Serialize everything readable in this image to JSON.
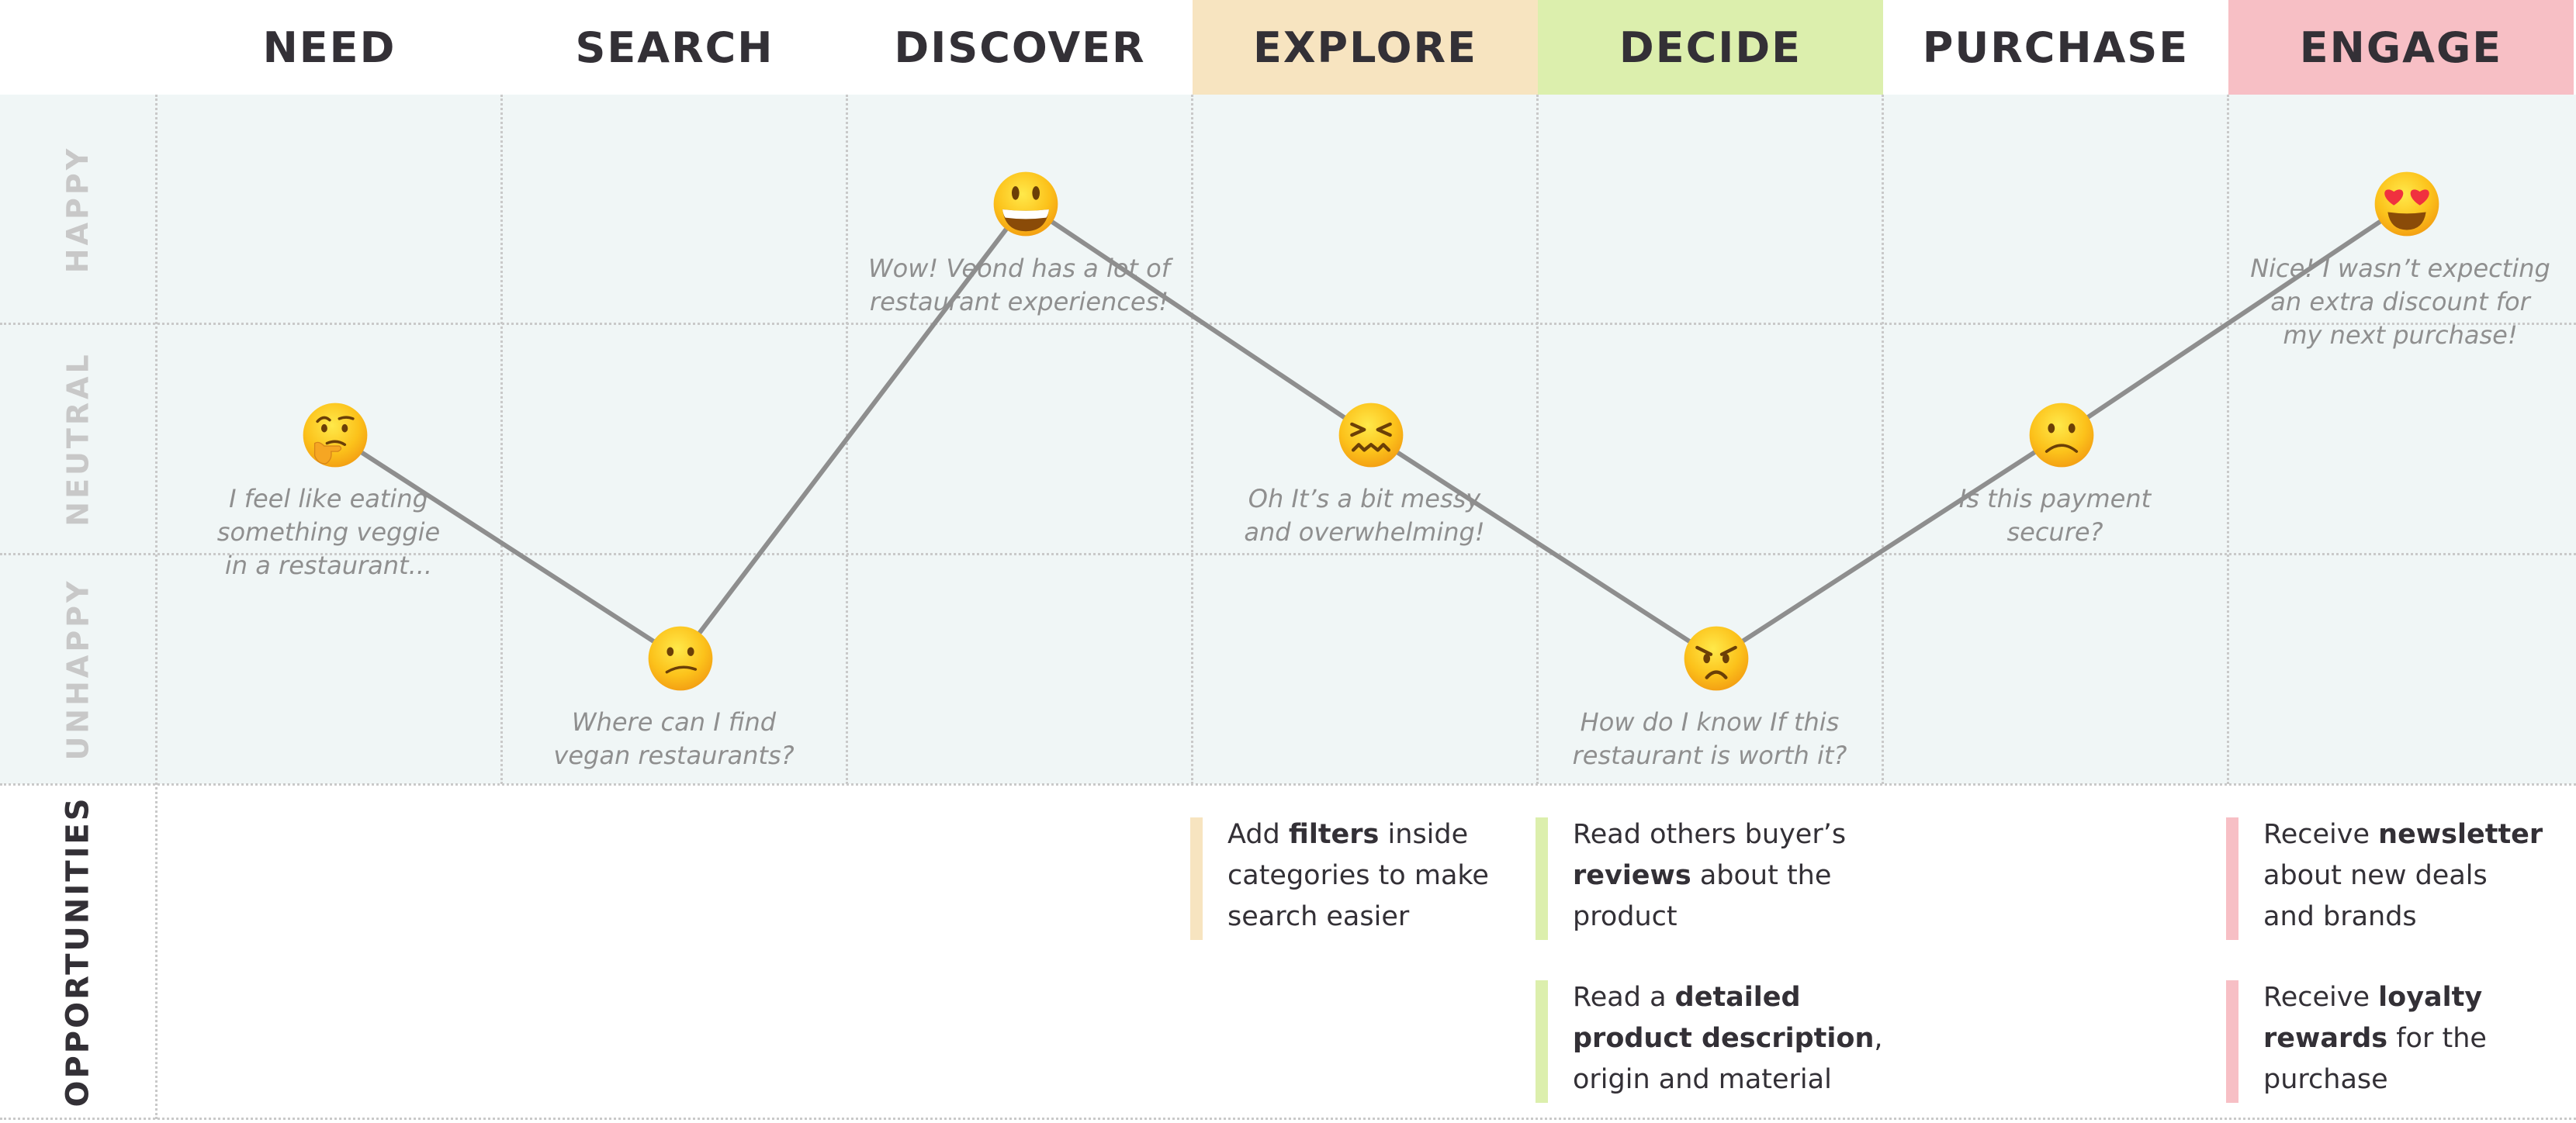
{
  "stages": [
    {
      "label": "NEED",
      "header_color": "#ffffff",
      "emotion": "neutral",
      "emoji_icon": "thinking-face-icon",
      "quote": [
        "I feel like eating",
        "something veggie",
        "in a restaurant..."
      ]
    },
    {
      "label": "SEARCH",
      "header_color": "#ffffff",
      "emotion": "unhappy",
      "emoji_icon": "confused-face-icon",
      "quote": [
        "Where can I find",
        "vegan restaurants?"
      ]
    },
    {
      "label": "DISCOVER",
      "header_color": "#ffffff",
      "emotion": "happy",
      "emoji_icon": "grinning-face-icon",
      "quote": [
        "Wow! Veond has a lot of",
        "restaurant experiences!"
      ]
    },
    {
      "label": "EXPLORE",
      "header_color": "#f7e4c0",
      "emotion": "neutral",
      "emoji_icon": "confounded-face-icon",
      "quote": [
        "Oh It’s a bit messy",
        "and overwhelming!"
      ]
    },
    {
      "label": "DECIDE",
      "header_color": "#dcefad",
      "emotion": "unhappy",
      "emoji_icon": "angry-face-icon",
      "quote": [
        "How do I know If this",
        "restaurant is worth it?"
      ]
    },
    {
      "label": "PURCHASE",
      "header_color": "#ffffff",
      "emotion": "neutral",
      "emoji_icon": "slightly-frowning-face-icon",
      "quote": [
        "Is this payment",
        "secure?"
      ]
    },
    {
      "label": "ENGAGE",
      "header_color": "#f7bfc5",
      "emotion": "happy",
      "emoji_icon": "heart-eyes-face-icon",
      "quote": [
        "Nice! I wasn’t expecting",
        "an extra discount for",
        "my next purchase!"
      ]
    }
  ],
  "row_labels": {
    "happy": "HAPPY",
    "neutral": "NEUTRAL",
    "unhappy": "UNHAPPY",
    "opportunities": "OPPORTUNITIES"
  },
  "opportunities": [
    {
      "stage": 3,
      "slot": 0,
      "color": "#f7e4c0",
      "lines": [
        [
          {
            "t": "Add "
          },
          {
            "t": "filters",
            "b": true
          },
          {
            "t": " inside"
          }
        ],
        [
          {
            "t": "categories  to make"
          }
        ],
        [
          {
            "t": "search easier"
          }
        ]
      ]
    },
    {
      "stage": 4,
      "slot": 0,
      "color": "#dcefad",
      "lines": [
        [
          {
            "t": "Read others buyer’s"
          }
        ],
        [
          {
            "t": "reviews",
            "b": true
          },
          {
            "t": " about the"
          }
        ],
        [
          {
            "t": "product"
          }
        ]
      ]
    },
    {
      "stage": 4,
      "slot": 1,
      "color": "#dcefad",
      "lines": [
        [
          {
            "t": "Read a "
          },
          {
            "t": "detailed",
            "b": true
          }
        ],
        [
          {
            "t": "product description",
            "b": true
          },
          {
            "t": ","
          }
        ],
        [
          {
            "t": "origin and material"
          }
        ]
      ]
    },
    {
      "stage": 6,
      "slot": 0,
      "color": "#f7bfc5",
      "lines": [
        [
          {
            "t": "Receive "
          },
          {
            "t": "newsletter",
            "b": true
          }
        ],
        [
          {
            "t": "about new deals"
          }
        ],
        [
          {
            "t": "and brands"
          }
        ]
      ]
    },
    {
      "stage": 6,
      "slot": 1,
      "color": "#f7bfc5",
      "lines": [
        [
          {
            "t": "Receive "
          },
          {
            "t": "loyalty",
            "b": true
          }
        ],
        [
          {
            "t": "rewards",
            "b": true
          },
          {
            "t": " for the"
          }
        ],
        [
          {
            "t": "purchase"
          }
        ]
      ]
    }
  ],
  "colors": {
    "emotion_background": "#f0f6f6",
    "journey_line": "#8e8e8e",
    "text": "#333036",
    "quote_text": "#8f8f8f",
    "row_label": "#c8c8c8"
  }
}
